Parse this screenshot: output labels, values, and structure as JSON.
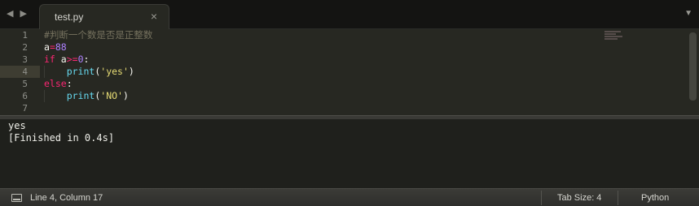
{
  "tabbar": {
    "back_glyph": "◀",
    "forward_glyph": "▶",
    "tab_label": "test.py",
    "close_glyph": "×",
    "dropdown_glyph": "▼"
  },
  "editor": {
    "lines": [
      {
        "n": "1",
        "tokens": [
          {
            "t": "#判断一个数是否是正整数",
            "c": "cm"
          }
        ]
      },
      {
        "n": "2",
        "tokens": [
          {
            "t": "a",
            "c": "var"
          },
          {
            "t": "=",
            "c": "op"
          },
          {
            "t": "88",
            "c": "num"
          }
        ]
      },
      {
        "n": "3",
        "tokens": [
          {
            "t": "if",
            "c": "kw"
          },
          {
            "t": " a",
            "c": "var"
          },
          {
            "t": ">=",
            "c": "op"
          },
          {
            "t": "0",
            "c": "num"
          },
          {
            "t": ":",
            "c": "pun"
          }
        ]
      },
      {
        "n": "4",
        "tokens": [
          {
            "t": "    ",
            "c": "var"
          },
          {
            "t": "print",
            "c": "fn"
          },
          {
            "t": "(",
            "c": "pun"
          },
          {
            "t": "'yes'",
            "c": "str"
          },
          {
            "t": ")",
            "c": "pun"
          }
        ]
      },
      {
        "n": "5",
        "tokens": [
          {
            "t": "else",
            "c": "kw"
          },
          {
            "t": ":",
            "c": "pun"
          }
        ]
      },
      {
        "n": "6",
        "tokens": [
          {
            "t": "    ",
            "c": "var"
          },
          {
            "t": "print",
            "c": "fn"
          },
          {
            "t": "(",
            "c": "pun"
          },
          {
            "t": "'NO'",
            "c": "str"
          },
          {
            "t": ")",
            "c": "pun"
          }
        ]
      },
      {
        "n": "7",
        "tokens": []
      }
    ],
    "active_line": 4
  },
  "output": {
    "lines": [
      "yes",
      "[Finished in 0.4s]"
    ]
  },
  "statusbar": {
    "position": "Line 4, Column 17",
    "tab_size": "Tab Size: 4",
    "syntax": "Python"
  },
  "theme": {
    "background": "#272822",
    "keyword": "#f92672",
    "number": "#ae81ff",
    "string": "#e6db74",
    "function": "#66d9ef",
    "comment": "#75715e"
  }
}
